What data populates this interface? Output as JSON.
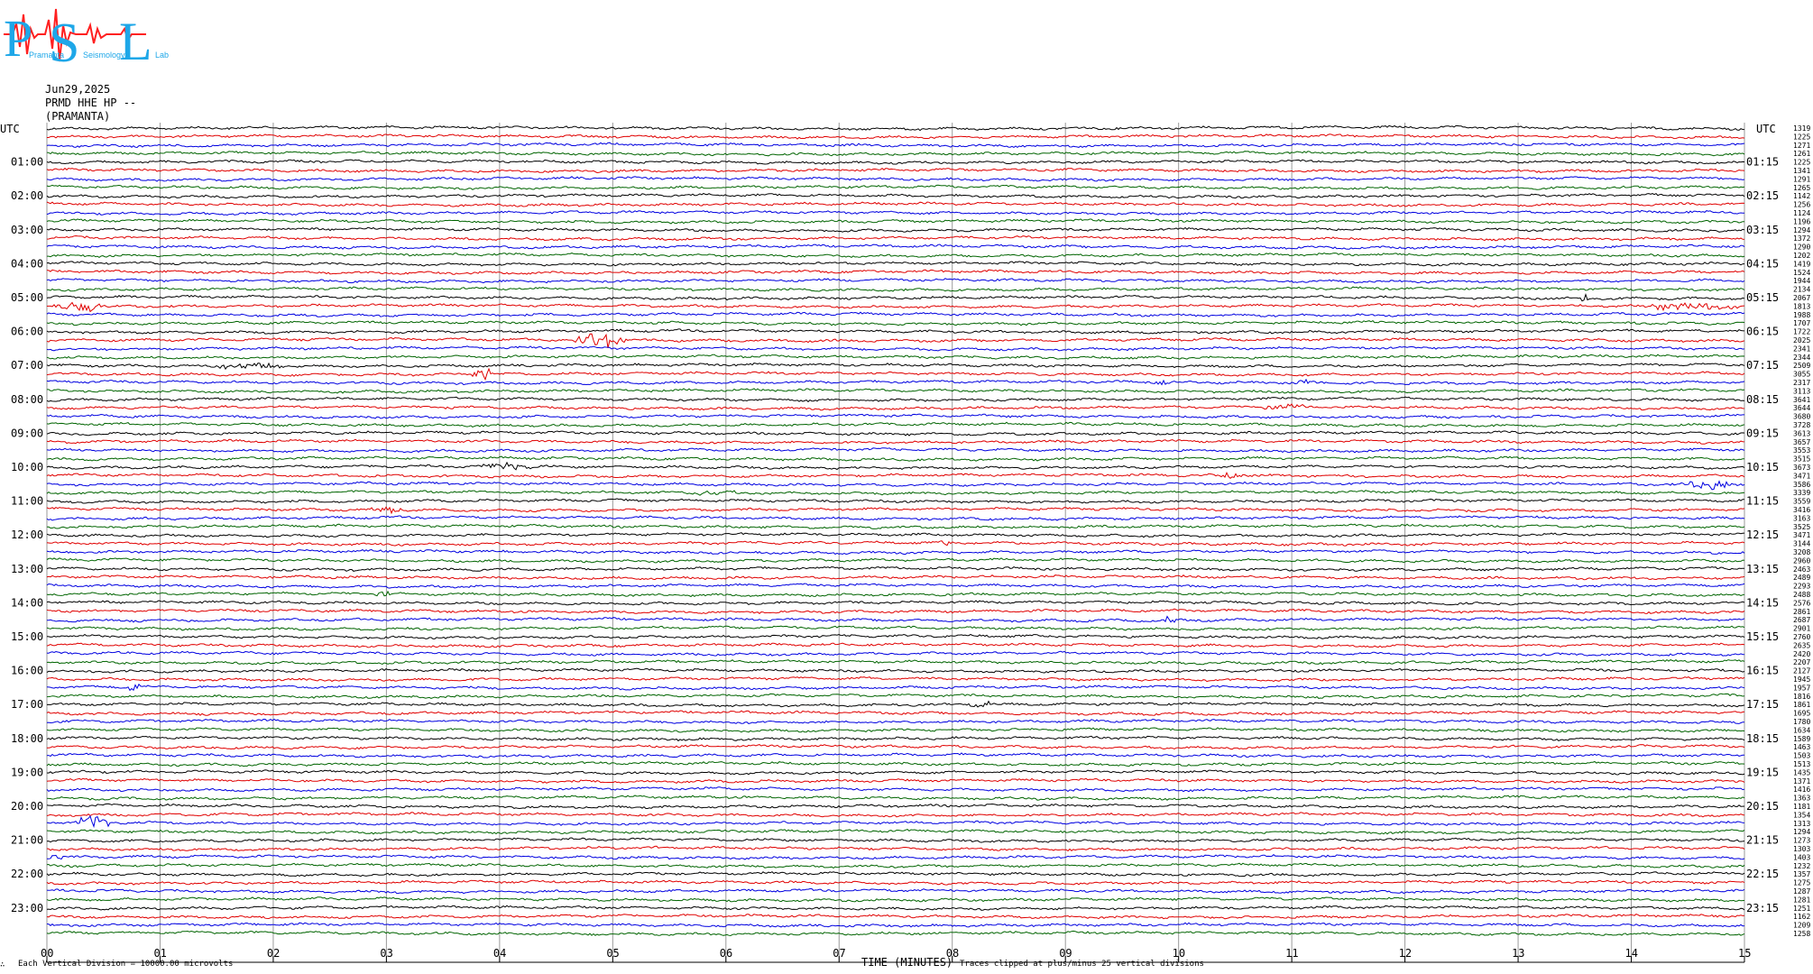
{
  "logo": {
    "letters": "PSL",
    "small_text_1": "Pramanta",
    "small_text_2": "Seismology",
    "small_text_3": "Lab",
    "colors": {
      "letters": "#1ea7e8",
      "waveform": "#ff2020"
    }
  },
  "header": {
    "date": "Jun29,2025",
    "channel": "PRMD HHE HP --",
    "station": "(PRAMANTA)"
  },
  "axes": {
    "left_top_label": "UTC",
    "right_top_label": "UTC",
    "left_hour_labels": [
      "01:00",
      "02:00",
      "03:00",
      "04:00",
      "05:00",
      "06:00",
      "07:00",
      "08:00",
      "09:00",
      "10:00",
      "11:00",
      "12:00",
      "13:00",
      "14:00",
      "15:00",
      "16:00",
      "17:00",
      "18:00",
      "19:00",
      "20:00",
      "21:00",
      "22:00",
      "23:00"
    ],
    "right_hour_labels": [
      "01:15",
      "02:15",
      "03:15",
      "04:15",
      "05:15",
      "06:15",
      "07:15",
      "08:15",
      "09:15",
      "10:15",
      "11:15",
      "12:15",
      "13:15",
      "14:15",
      "15:15",
      "16:15",
      "17:15",
      "18:15",
      "19:15",
      "20:15",
      "21:15",
      "22:15",
      "23:15"
    ],
    "x_tick_labels": [
      "00",
      "01",
      "02",
      "03",
      "04",
      "05",
      "06",
      "07",
      "08",
      "09",
      "10",
      "11",
      "12",
      "13",
      "14",
      "15"
    ],
    "x_title": "TIME (MINUTES)"
  },
  "footer": {
    "left_note": "Each Vertical Division = 10000.00 microvolts",
    "clip_note": "Traces clipped at plus/minus 25 vertical divisions",
    "corner_mark": "∴"
  },
  "chart_data": {
    "type": "line",
    "title": "",
    "xlabel": "TIME (MINUTES)",
    "xlim": [
      0,
      15
    ],
    "traces_per_hour": 4,
    "trace_count": 96,
    "trace_colors": [
      "#000000",
      "#e00000",
      "#0000e0",
      "#006400"
    ],
    "grid": "vertical lines at each minute",
    "right_scale_values": [
      "1319",
      "1225",
      "1271",
      "1261",
      "1225",
      "1341",
      "1291",
      "1265",
      "1142",
      "1256",
      "1124",
      "1196",
      "1294",
      "1372",
      "1290",
      "1202",
      "1419",
      "1524",
      "1944",
      "2134",
      "2067",
      "1813",
      "1988",
      "1707",
      "1722",
      "2025",
      "2341",
      "2344",
      "2509",
      "3055",
      "2317",
      "3113",
      "3641",
      "3644",
      "3680",
      "3728",
      "3613",
      "3657",
      "3553",
      "3515",
      "3673",
      "3471",
      "3586",
      "3339",
      "3559",
      "3416",
      "3163",
      "3525",
      "3471",
      "3144",
      "3208",
      "2960",
      "2463",
      "2489",
      "2293",
      "2488",
      "2576",
      "2861",
      "2687",
      "2901",
      "2760",
      "2635",
      "2420",
      "2207",
      "2127",
      "1945",
      "1957",
      "1816",
      "1861",
      "1695",
      "1780",
      "1634",
      "1589",
      "1463",
      "1503",
      "1513",
      "1435",
      "1371",
      "1416",
      "1363",
      "1181",
      "1354",
      "1313",
      "1294",
      "1273",
      "1303",
      "1403",
      "1232",
      "1357",
      "1275",
      "1287",
      "1281",
      "1251",
      "1162",
      "1209",
      "1258"
    ],
    "events": [
      {
        "trace": 21,
        "start_min": 0.0,
        "end_min": 0.6,
        "amplitude": 5,
        "color_index": 2
      },
      {
        "trace": 20,
        "start_min": 13.55,
        "end_min": 13.62,
        "amplitude": 8,
        "color_index": 0
      },
      {
        "trace": 21,
        "start_min": 14.0,
        "end_min": 15.0,
        "amplitude": 4,
        "color_index": 1
      },
      {
        "trace": 25,
        "start_min": 4.6,
        "end_min": 5.15,
        "amplitude": 9,
        "color_index": 1
      },
      {
        "trace": 28,
        "start_min": 1.3,
        "end_min": 2.2,
        "amplitude": 3,
        "color_index": 0
      },
      {
        "trace": 29,
        "start_min": 3.75,
        "end_min": 3.95,
        "amplitude": 9,
        "color_index": 1
      },
      {
        "trace": 30,
        "start_min": 9.8,
        "end_min": 9.95,
        "amplitude": 3,
        "color_index": 2
      },
      {
        "trace": 30,
        "start_min": 11.0,
        "end_min": 11.2,
        "amplitude": 3,
        "color_index": 2
      },
      {
        "trace": 33,
        "start_min": 10.7,
        "end_min": 11.2,
        "amplitude": 3,
        "color_index": 1
      },
      {
        "trace": 40,
        "start_min": 3.8,
        "end_min": 4.4,
        "amplitude": 4,
        "color_index": 0
      },
      {
        "trace": 41,
        "start_min": 10.3,
        "end_min": 10.6,
        "amplitude": 3,
        "color_index": 3
      },
      {
        "trace": 42,
        "start_min": 14.4,
        "end_min": 15.0,
        "amplitude": 5,
        "color_index": 2
      },
      {
        "trace": 43,
        "start_min": 5.5,
        "end_min": 6.2,
        "amplitude": 3,
        "color_index": 0
      },
      {
        "trace": 45,
        "start_min": 2.8,
        "end_min": 3.2,
        "amplitude": 3,
        "color_index": 2
      },
      {
        "trace": 49,
        "start_min": 7.9,
        "end_min": 8.05,
        "amplitude": 4,
        "color_index": 1
      },
      {
        "trace": 55,
        "start_min": 2.9,
        "end_min": 3.05,
        "amplitude": 4,
        "color_index": 0
      },
      {
        "trace": 58,
        "start_min": 9.85,
        "end_min": 10.0,
        "amplitude": 4,
        "color_index": 3
      },
      {
        "trace": 66,
        "start_min": 0.7,
        "end_min": 0.85,
        "amplitude": 5,
        "color_index": 2
      },
      {
        "trace": 68,
        "start_min": 8.1,
        "end_min": 8.5,
        "amplitude": 3,
        "color_index": 0
      },
      {
        "trace": 82,
        "start_min": 0.25,
        "end_min": 0.6,
        "amplitude": 9,
        "color_index": 2
      },
      {
        "trace": 86,
        "start_min": 0.0,
        "end_min": 0.2,
        "amplitude": 3,
        "color_index": 1
      }
    ]
  }
}
